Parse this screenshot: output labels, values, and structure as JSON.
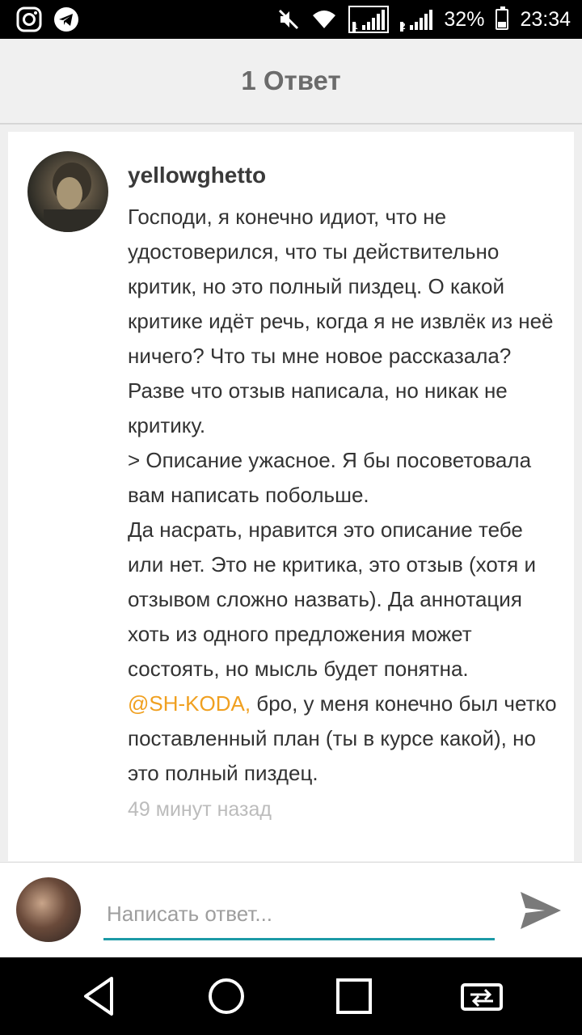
{
  "status_bar": {
    "icons_left": [
      "instagram-icon",
      "telegram-icon"
    ],
    "icons_right": [
      "mute-icon",
      "wifi-icon",
      "signal-sim1-icon",
      "signal-sim2-icon",
      "battery-icon"
    ],
    "sim1_label": "1",
    "sim2_label": "2",
    "battery_percent": "32%",
    "battery_level": 0.32,
    "time": "23:34"
  },
  "header": {
    "title": "1 Ответ"
  },
  "comment": {
    "username": "yellowghetto",
    "body": "Господи, я конечно идиот, что не удостоверился, что ты действительно критик, но это полный пиздец. О какой критике идёт речь, когда я не извлёк из неё ничего? Что ты мне новое рассказала? Разве что отзыв написала, но никак не критику.\n> Описание ужасное. Я бы посоветовала вам написать побольше.\nДа насрать, нравится это описание тебе или нет. Это не критика, это отзыв (хотя и отзывом сложно назвать). Да аннотация хоть из одного предложения может состоять, но мысль будет понятна.",
    "mention": "@SH-KODA,",
    "mention_text": " бро, у меня конечно был четко поставленный план (ты в курсе какой), но это полный пиздец.",
    "timestamp": "49 минут назад"
  },
  "reply": {
    "placeholder": "Написать ответ..."
  },
  "colors": {
    "accent": "#1c9aa6",
    "mention": "#f0a020",
    "header_bg": "#f0f0f0"
  }
}
